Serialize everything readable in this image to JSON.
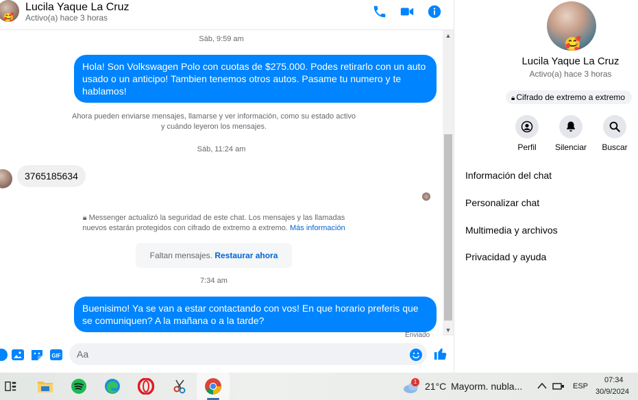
{
  "header": {
    "name": "Lucila Yaque La Cruz",
    "status": "Activo(a) hace 3 horas"
  },
  "messages": {
    "ts1": "Sáb, 9:59 am",
    "out1": "Hola! Son Volkswagen Polo con cuotas de $275.000. Podes retirarlo con un auto usado o un anticipo! Tambien tenemos otros autos. Pasame tu numero y te hablamos!",
    "sys1_line1": "Ahora pueden enviarse mensajes, llamarse y ver información, como su estado activo",
    "sys1_line2": "y cuándo leyeron los mensajes.",
    "ts2": "Sáb, 11:24 am",
    "in1": "3765185634",
    "sys2_line1": "Messenger actualizó la seguridad de este chat. Los mensajes y las llamadas",
    "sys2_line2": "nuevos estarán protegidos con cifrado de extremo a extremo.",
    "sys2_link": "Más información",
    "missing_text": "Faltan mensajes.",
    "missing_link": "Restaurar ahora",
    "ts3": "7:34 am",
    "out2": "Buenisimo! Ya se van a estar contactando con vos! En que horario preferis que se comuniquen? A la mañana o a la tarde?",
    "sent": "Enviado"
  },
  "composer": {
    "placeholder": "Aa"
  },
  "info": {
    "name": "Lucila Yaque La Cruz",
    "status": "Activo(a) hace 3 horas",
    "e2e": "Cifrado de extremo a extremo",
    "actions": [
      "Perfil",
      "Silenciar",
      "Buscar"
    ],
    "menu": [
      "Información del chat",
      "Personalizar chat",
      "Multimedia y archivos",
      "Privacidad y ayuda"
    ]
  },
  "taskbar": {
    "weather_temp": "21°C",
    "weather_desc": "Mayorm. nubla...",
    "weather_badge": "1",
    "lang": "ESP",
    "time": "07:34",
    "date": "30/9/2024"
  },
  "colors": {
    "messenger_blue": "#0084ff",
    "link_blue": "#0064d1",
    "secondary_text": "#65676b"
  }
}
